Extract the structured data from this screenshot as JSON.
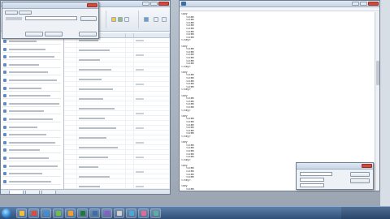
{
  "excel": {
    "title": "",
    "menu": [
      "",
      "",
      "",
      "",
      "",
      "",
      ""
    ],
    "sheet_tabs": [
      "",
      "",
      ""
    ],
    "left_panel_items": [
      "",
      "",
      "",
      "",
      "",
      "",
      "",
      "",
      "",
      "",
      "",
      "",
      "",
      "",
      "",
      "",
      "",
      "",
      ""
    ],
    "column_headers": [
      "",
      "",
      "",
      ""
    ]
  },
  "find_dialog": {
    "title": "",
    "tab_labels": [
      "",
      ""
    ],
    "find_label": "",
    "find_value": "",
    "buttons": [
      "",
      "",
      "",
      ""
    ]
  },
  "notepad": {
    "title": "",
    "menu": [
      "",
      "",
      "",
      "",
      ""
    ],
    "lines": [
      "<key",
      "<item",
      "<item",
      "<item",
      "<item",
      "<item",
      "<item",
      "<item",
      "<item",
      "</key>",
      "",
      "<key",
      "<item",
      "<item",
      "<item",
      "<item",
      "<item",
      "<item",
      "</key>",
      "",
      "<key",
      "<item",
      "<item",
      "<item",
      "<item",
      "<item",
      "</key>",
      "",
      "<key",
      "<item",
      "<item",
      "<item",
      "<item",
      "</key>",
      "",
      "<key",
      "<item",
      "<item",
      "<item",
      "<item",
      "<item",
      "<item",
      "</key>",
      "",
      "<key",
      "<item",
      "<item",
      "<item",
      "<item",
      "<item",
      "</key>",
      "",
      "<key",
      "<item",
      "<item",
      "<item",
      "<item",
      "</key>",
      "",
      "<key",
      "<item",
      "<item",
      "</key>"
    ]
  },
  "small_dialog": {
    "title": "",
    "options": [
      "",
      "",
      ""
    ],
    "buttons": [
      "",
      ""
    ]
  },
  "taskbar": {
    "clock_time": "",
    "clock_date": "",
    "tray_text": ""
  },
  "colors": {
    "taskbar": "#2f4f78",
    "window_border": "#6e7d8f",
    "excel_accent": "#1f7a3a",
    "notepad_accent": "#3a6ea5",
    "close_button": "#cf4b3c"
  }
}
